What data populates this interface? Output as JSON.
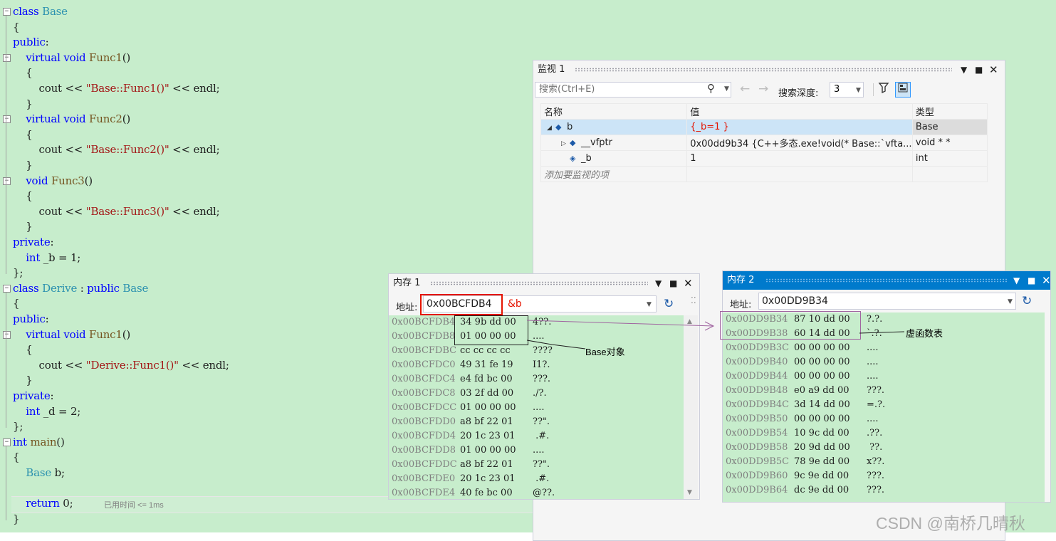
{
  "editor": {
    "lines": [
      {
        "row": 0,
        "segs": [
          [
            "kw",
            "class"
          ],
          [
            "",
            ""
          ],
          [
            "ty",
            " Base"
          ]
        ]
      },
      {
        "row": 1,
        "segs": [
          [
            "",
            "{"
          ]
        ]
      },
      {
        "row": 2,
        "segs": [
          [
            "kw",
            "public"
          ],
          [
            "",
            ":"
          ]
        ]
      },
      {
        "row": 3,
        "segs": [
          [
            "",
            "    "
          ],
          [
            "kw",
            "virtual"
          ],
          [
            "kw",
            " void"
          ],
          [
            "fn",
            " Func1"
          ],
          [
            "",
            "()"
          ]
        ]
      },
      {
        "row": 4,
        "segs": [
          [
            "",
            "    {"
          ]
        ]
      },
      {
        "row": 5,
        "segs": [
          [
            "",
            "        cout "
          ],
          [
            "",
            "<<"
          ],
          [
            "st",
            " \"Base::Func1()\""
          ],
          [
            "",
            " << endl;"
          ]
        ]
      },
      {
        "row": 6,
        "segs": [
          [
            "",
            "    }"
          ]
        ]
      },
      {
        "row": 7,
        "segs": [
          [
            "",
            "    "
          ],
          [
            "kw",
            "virtual"
          ],
          [
            "kw",
            " void"
          ],
          [
            "fn",
            " Func2"
          ],
          [
            "",
            "()"
          ]
        ]
      },
      {
        "row": 8,
        "segs": [
          [
            "",
            "    {"
          ]
        ]
      },
      {
        "row": 9,
        "segs": [
          [
            "",
            "        cout "
          ],
          [
            "",
            "<<"
          ],
          [
            "st",
            " \"Base::Func2()\""
          ],
          [
            "",
            " << endl;"
          ]
        ]
      },
      {
        "row": 10,
        "segs": [
          [
            "",
            "    }"
          ]
        ]
      },
      {
        "row": 11,
        "segs": [
          [
            "",
            "    "
          ],
          [
            "kw",
            "void"
          ],
          [
            "fn",
            " Func3"
          ],
          [
            "",
            "()"
          ]
        ]
      },
      {
        "row": 12,
        "segs": [
          [
            "",
            "    {"
          ]
        ]
      },
      {
        "row": 13,
        "segs": [
          [
            "",
            "        cout "
          ],
          [
            "",
            "<<"
          ],
          [
            "st",
            " \"Base::Func3()\""
          ],
          [
            "",
            " << endl;"
          ]
        ]
      },
      {
        "row": 14,
        "segs": [
          [
            "",
            "    }"
          ]
        ]
      },
      {
        "row": 15,
        "segs": [
          [
            "kw",
            "private"
          ],
          [
            "",
            ":"
          ]
        ]
      },
      {
        "row": 16,
        "segs": [
          [
            "",
            "    "
          ],
          [
            "kw",
            "int"
          ],
          [
            "",
            " _b = 1;"
          ]
        ]
      },
      {
        "row": 17,
        "segs": [
          [
            "",
            "};"
          ]
        ]
      },
      {
        "row": 18,
        "segs": [
          [
            "kw",
            "class"
          ],
          [
            "ty",
            " Derive"
          ],
          [
            "",
            " : "
          ],
          [
            "kw",
            "public"
          ],
          [
            "ty",
            " Base"
          ]
        ]
      },
      {
        "row": 19,
        "segs": [
          [
            "",
            "{"
          ]
        ]
      },
      {
        "row": 20,
        "segs": [
          [
            "kw",
            "public"
          ],
          [
            "",
            ":"
          ]
        ]
      },
      {
        "row": 21,
        "segs": [
          [
            "",
            "    "
          ],
          [
            "kw",
            "virtual"
          ],
          [
            "kw",
            " void"
          ],
          [
            "fn",
            " Func1"
          ],
          [
            "",
            "()"
          ]
        ]
      },
      {
        "row": 22,
        "segs": [
          [
            "",
            "    {"
          ]
        ]
      },
      {
        "row": 23,
        "segs": [
          [
            "",
            "        cout "
          ],
          [
            "",
            "<<"
          ],
          [
            "st",
            " \"Derive::Func1()\""
          ],
          [
            "",
            " << endl;"
          ]
        ]
      },
      {
        "row": 24,
        "segs": [
          [
            "",
            "    }"
          ]
        ]
      },
      {
        "row": 25,
        "segs": [
          [
            "kw",
            "private"
          ],
          [
            "",
            ":"
          ]
        ]
      },
      {
        "row": 26,
        "segs": [
          [
            "",
            "    "
          ],
          [
            "kw",
            "int"
          ],
          [
            "",
            " _d = 2;"
          ]
        ]
      },
      {
        "row": 27,
        "segs": [
          [
            "",
            "};"
          ]
        ]
      },
      {
        "row": 28,
        "segs": [
          [
            "kw",
            "int"
          ],
          [
            "fn",
            " main"
          ],
          [
            "",
            "()"
          ]
        ]
      },
      {
        "row": 29,
        "segs": [
          [
            "",
            "{"
          ]
        ]
      },
      {
        "row": 30,
        "segs": [
          [
            "",
            "    "
          ],
          [
            "ty",
            "Base"
          ],
          [
            "",
            " b;"
          ]
        ]
      },
      {
        "row": 31,
        "segs": [
          [
            "",
            ""
          ]
        ]
      },
      {
        "row": 32,
        "segs": [
          [
            "",
            "    "
          ],
          [
            "kw",
            "return"
          ],
          [
            "",
            " 0;"
          ]
        ]
      },
      {
        "row": 33,
        "segs": [
          [
            "",
            "}"
          ]
        ]
      }
    ],
    "perf_tip": "已用时间 <= 1ms",
    "colors": {
      "background": "#c7edcc",
      "keyword": "#0000ff",
      "type": "#2b91af",
      "string": "#a31515"
    }
  },
  "watch": {
    "title": "监视 1",
    "search_placeholder": "搜索(Ctrl+E)",
    "depth_label": "搜索深度:",
    "depth_value": "3",
    "columns": [
      "名称",
      "值",
      "类型"
    ],
    "rows": [
      {
        "name": "b",
        "value": "{_b=1 }",
        "type": "Base",
        "expander": "◢",
        "icon": "object-icon",
        "selected": true,
        "value_red": true,
        "indent": 0
      },
      {
        "name": "__vfptr",
        "value": "0x00dd9b34 {C++多态.exe!void(* Base::`vfta...",
        "type": "void * *",
        "expander": "▷",
        "icon": "object-icon",
        "selected": false,
        "value_red": false,
        "indent": 1
      },
      {
        "name": "_b",
        "value": "1",
        "type": "int",
        "expander": "",
        "icon": "field-icon",
        "selected": false,
        "value_red": false,
        "indent": 1
      }
    ],
    "add_item": "添加要监视的项"
  },
  "memory1": {
    "title": "内存 1",
    "address_label": "地址:",
    "address_value": "0x00BCFDB4",
    "address_hint": "&b",
    "rows": [
      {
        "addr": "0x00BCFDB4",
        "bytes": "34 9b dd 00",
        "ascii": "4??."
      },
      {
        "addr": "0x00BCFDB8",
        "bytes": "01 00 00 00",
        "ascii": "...."
      },
      {
        "addr": "0x00BCFDBC",
        "bytes": "cc cc cc cc",
        "ascii": "????"
      },
      {
        "addr": "0x00BCFDC0",
        "bytes": "49 31 fe 19",
        "ascii": "I1?."
      },
      {
        "addr": "0x00BCFDC4",
        "bytes": "e4 fd bc 00",
        "ascii": "???."
      },
      {
        "addr": "0x00BCFDC8",
        "bytes": "03 2f dd 00",
        "ascii": "./?."
      },
      {
        "addr": "0x00BCFDCC",
        "bytes": "01 00 00 00",
        "ascii": "...."
      },
      {
        "addr": "0x00BCFDD0",
        "bytes": "a8 bf 22 01",
        "ascii": "??\"."
      },
      {
        "addr": "0x00BCFDD4",
        "bytes": "20 1c 23 01",
        "ascii": " .#."
      },
      {
        "addr": "0x00BCFDD8",
        "bytes": "01 00 00 00",
        "ascii": "...."
      },
      {
        "addr": "0x00BCFDDC",
        "bytes": "a8 bf 22 01",
        "ascii": "??\"."
      },
      {
        "addr": "0x00BCFDE0",
        "bytes": "20 1c 23 01",
        "ascii": " .#."
      },
      {
        "addr": "0x00BCFDE4",
        "bytes": "40 fe bc 00",
        "ascii": "@??."
      }
    ]
  },
  "memory2": {
    "title": "内存 2",
    "address_label": "地址:",
    "address_value": "0x00DD9B34",
    "rows": [
      {
        "addr": "0x00DD9B34",
        "bytes": "87 10 dd 00",
        "ascii": "?.?."
      },
      {
        "addr": "0x00DD9B38",
        "bytes": "60 14 dd 00",
        "ascii": "`.?."
      },
      {
        "addr": "0x00DD9B3C",
        "bytes": "00 00 00 00",
        "ascii": "...."
      },
      {
        "addr": "0x00DD9B40",
        "bytes": "00 00 00 00",
        "ascii": "...."
      },
      {
        "addr": "0x00DD9B44",
        "bytes": "00 00 00 00",
        "ascii": "...."
      },
      {
        "addr": "0x00DD9B48",
        "bytes": "e0 a9 dd 00",
        "ascii": "???."
      },
      {
        "addr": "0x00DD9B4C",
        "bytes": "3d 14 dd 00",
        "ascii": "=.?."
      },
      {
        "addr": "0x00DD9B50",
        "bytes": "00 00 00 00",
        "ascii": "...."
      },
      {
        "addr": "0x00DD9B54",
        "bytes": "10 9c dd 00",
        "ascii": ".??."
      },
      {
        "addr": "0x00DD9B58",
        "bytes": "20 9d dd 00",
        "ascii": " ??."
      },
      {
        "addr": "0x00DD9B5C",
        "bytes": "78 9e dd 00",
        "ascii": "x??."
      },
      {
        "addr": "0x00DD9B60",
        "bytes": "9c 9e dd 00",
        "ascii": "???."
      },
      {
        "addr": "0x00DD9B64",
        "bytes": "dc 9e dd 00",
        "ascii": "???."
      }
    ]
  },
  "annotations": {
    "base_object": "Base对象",
    "vtable": "虚函数表"
  },
  "watermark": "CSDN @南桥几晴秋",
  "icons": {
    "pane_dropdown": "▼",
    "pane_maximize": "■",
    "pane_close": "✕",
    "search": "⚲",
    "back": "←",
    "forward": "→",
    "refresh": "↻"
  }
}
